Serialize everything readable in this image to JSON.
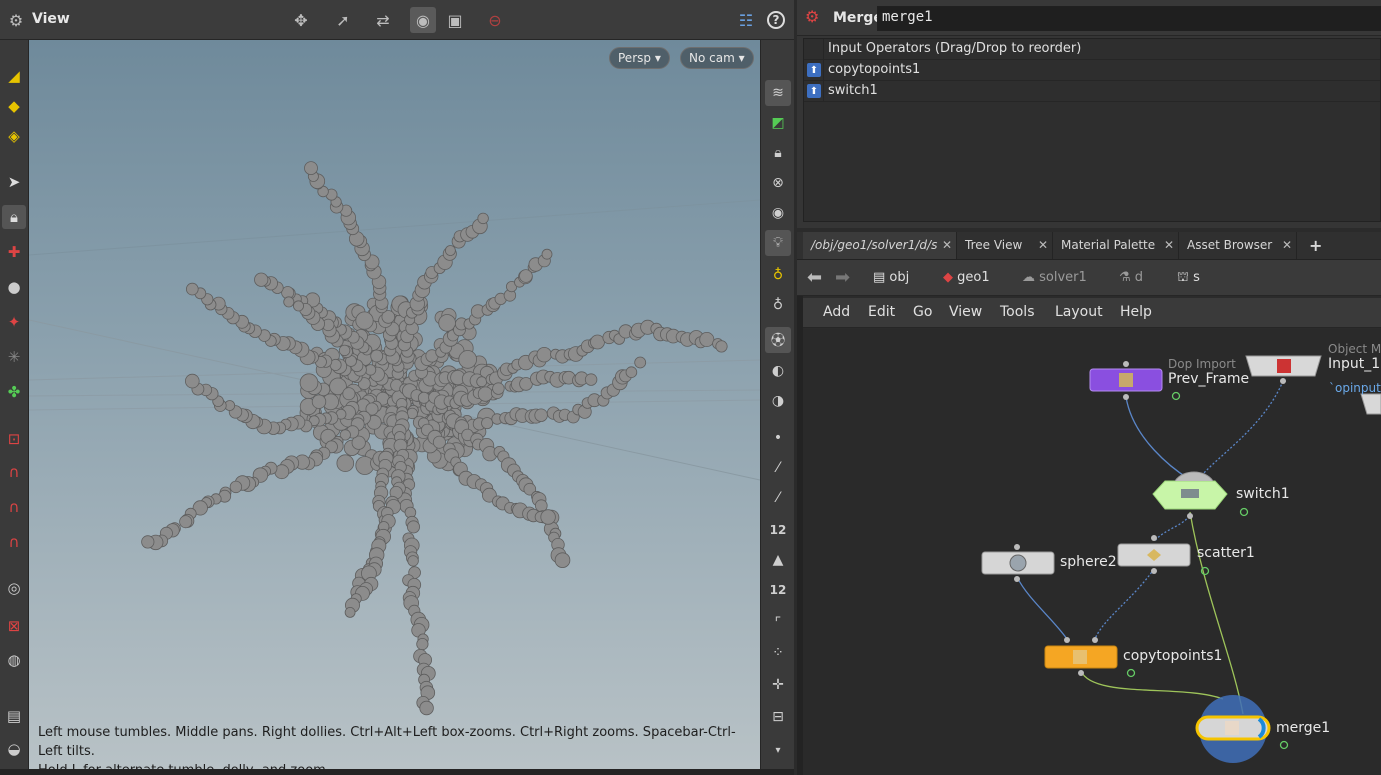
{
  "viewport": {
    "title": "View",
    "persp_label": "Persp",
    "cam_label": "No cam",
    "help_line1": "Left mouse tumbles. Middle pans. Right dollies. Ctrl+Alt+Left box-zooms. Ctrl+Right zooms. Spacebar-Ctrl-Left tilts.",
    "help_line2": "Hold L for alternate tumble, dolly, and zoom.",
    "right_shelf_num1": "12",
    "right_shelf_num2": "12"
  },
  "params": {
    "node_type": "Merge",
    "node_name": "merge1",
    "list_header": "Input Operators (Drag/Drop to reorder)",
    "inputs": [
      "copytopoints1",
      "switch1"
    ]
  },
  "network": {
    "tabs": [
      {
        "label": "/obj/geo1/solver1/d/s"
      },
      {
        "label": "Tree View"
      },
      {
        "label": "Material Palette"
      },
      {
        "label": "Asset Browser"
      }
    ],
    "add_tab": "+",
    "path": [
      "obj",
      "geo1",
      "solver1",
      "d",
      "s"
    ],
    "menu": [
      "Add",
      "Edit",
      "Go",
      "View",
      "Tools",
      "Layout",
      "Help"
    ],
    "nodes": {
      "prev_frame_type": "Dop Import",
      "prev_frame": "Prev_Frame",
      "input1_type": "Object Me",
      "input1": "Input_1",
      "input1_param": "`opinput",
      "switch1": "switch1",
      "scatter1": "scatter1",
      "sphere2": "sphere2",
      "copytopoints1": "copytopoints1",
      "merge1": "merge1"
    }
  },
  "colors": {
    "dop_node": "#8a4fe0",
    "switch_node": "#c8f5a8",
    "copy_node": "#f5a623",
    "merge_ring": "#1c8ad8",
    "display_flag": "#f5c400"
  }
}
